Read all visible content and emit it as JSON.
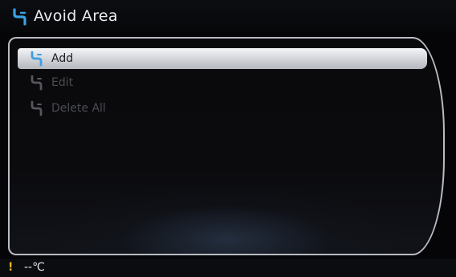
{
  "titlebar": {
    "title": "Avoid Area",
    "icon": "avoid-route-icon",
    "icon_color": "#3aa0e6"
  },
  "menu": {
    "items": [
      {
        "label": "Add",
        "icon": "avoid-route-icon",
        "state": "selected"
      },
      {
        "label": "Edit",
        "icon": "avoid-route-icon",
        "state": "disabled"
      },
      {
        "label": "Delete All",
        "icon": "avoid-route-icon",
        "state": "disabled"
      }
    ]
  },
  "statusbar": {
    "warning": "!",
    "temperature": "--℃",
    "warning_color": "#e2b424"
  }
}
